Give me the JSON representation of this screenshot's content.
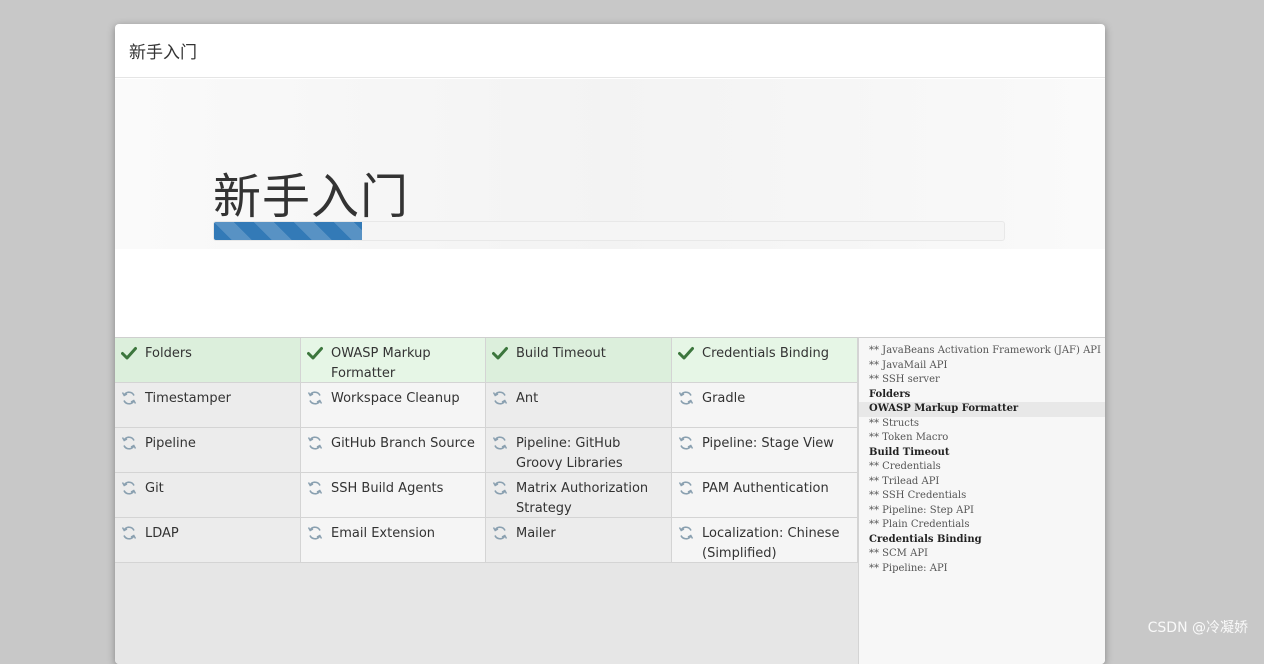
{
  "dialog": {
    "header_title": "新手入门",
    "hero_title": "新手入门",
    "progress_percent": 18.7
  },
  "plugins": [
    {
      "name": "Folders",
      "status": "done"
    },
    {
      "name": "OWASP Markup Formatter",
      "status": "done"
    },
    {
      "name": "Build Timeout",
      "status": "done"
    },
    {
      "name": "Credentials Binding",
      "status": "done"
    },
    {
      "name": "Timestamper",
      "status": "pending"
    },
    {
      "name": "Workspace Cleanup",
      "status": "pending"
    },
    {
      "name": "Ant",
      "status": "pending"
    },
    {
      "name": "Gradle",
      "status": "pending"
    },
    {
      "name": "Pipeline",
      "status": "pending"
    },
    {
      "name": "GitHub Branch Source",
      "status": "pending"
    },
    {
      "name": "Pipeline: GitHub Groovy Libraries",
      "status": "pending"
    },
    {
      "name": "Pipeline: Stage View",
      "status": "pending"
    },
    {
      "name": "Git",
      "status": "pending"
    },
    {
      "name": "SSH Build Agents",
      "status": "pending"
    },
    {
      "name": "Matrix Authorization Strategy",
      "status": "pending"
    },
    {
      "name": "PAM Authentication",
      "status": "pending"
    },
    {
      "name": "LDAP",
      "status": "pending"
    },
    {
      "name": "Email Extension",
      "status": "pending"
    },
    {
      "name": "Mailer",
      "status": "pending"
    },
    {
      "name": "Localization: Chinese (Simplified)",
      "status": "pending"
    }
  ],
  "log": [
    {
      "text": "** JavaBeans Activation Framework (JAF) API",
      "plugin": false
    },
    {
      "text": "** JavaMail API",
      "plugin": false
    },
    {
      "text": "** SSH server",
      "plugin": false
    },
    {
      "text": "Folders",
      "plugin": true
    },
    {
      "text": "OWASP Markup Formatter",
      "plugin": true,
      "highlight": true
    },
    {
      "text": "** Structs",
      "plugin": false
    },
    {
      "text": "** Token Macro",
      "plugin": false
    },
    {
      "text": "Build Timeout",
      "plugin": true
    },
    {
      "text": "** Credentials",
      "plugin": false
    },
    {
      "text": "** Trilead API",
      "plugin": false
    },
    {
      "text": "** SSH Credentials",
      "plugin": false
    },
    {
      "text": "** Pipeline: Step API",
      "plugin": false
    },
    {
      "text": "** Plain Credentials",
      "plugin": false
    },
    {
      "text": "Credentials Binding",
      "plugin": true
    },
    {
      "text": "** SCM API",
      "plugin": false
    },
    {
      "text": "** Pipeline: API",
      "plugin": false
    }
  ],
  "watermark": "CSDN @冷凝娇",
  "colors": {
    "progress": "#337ab7",
    "check": "#3c763d",
    "pending_icon": "#8aa0b0"
  }
}
